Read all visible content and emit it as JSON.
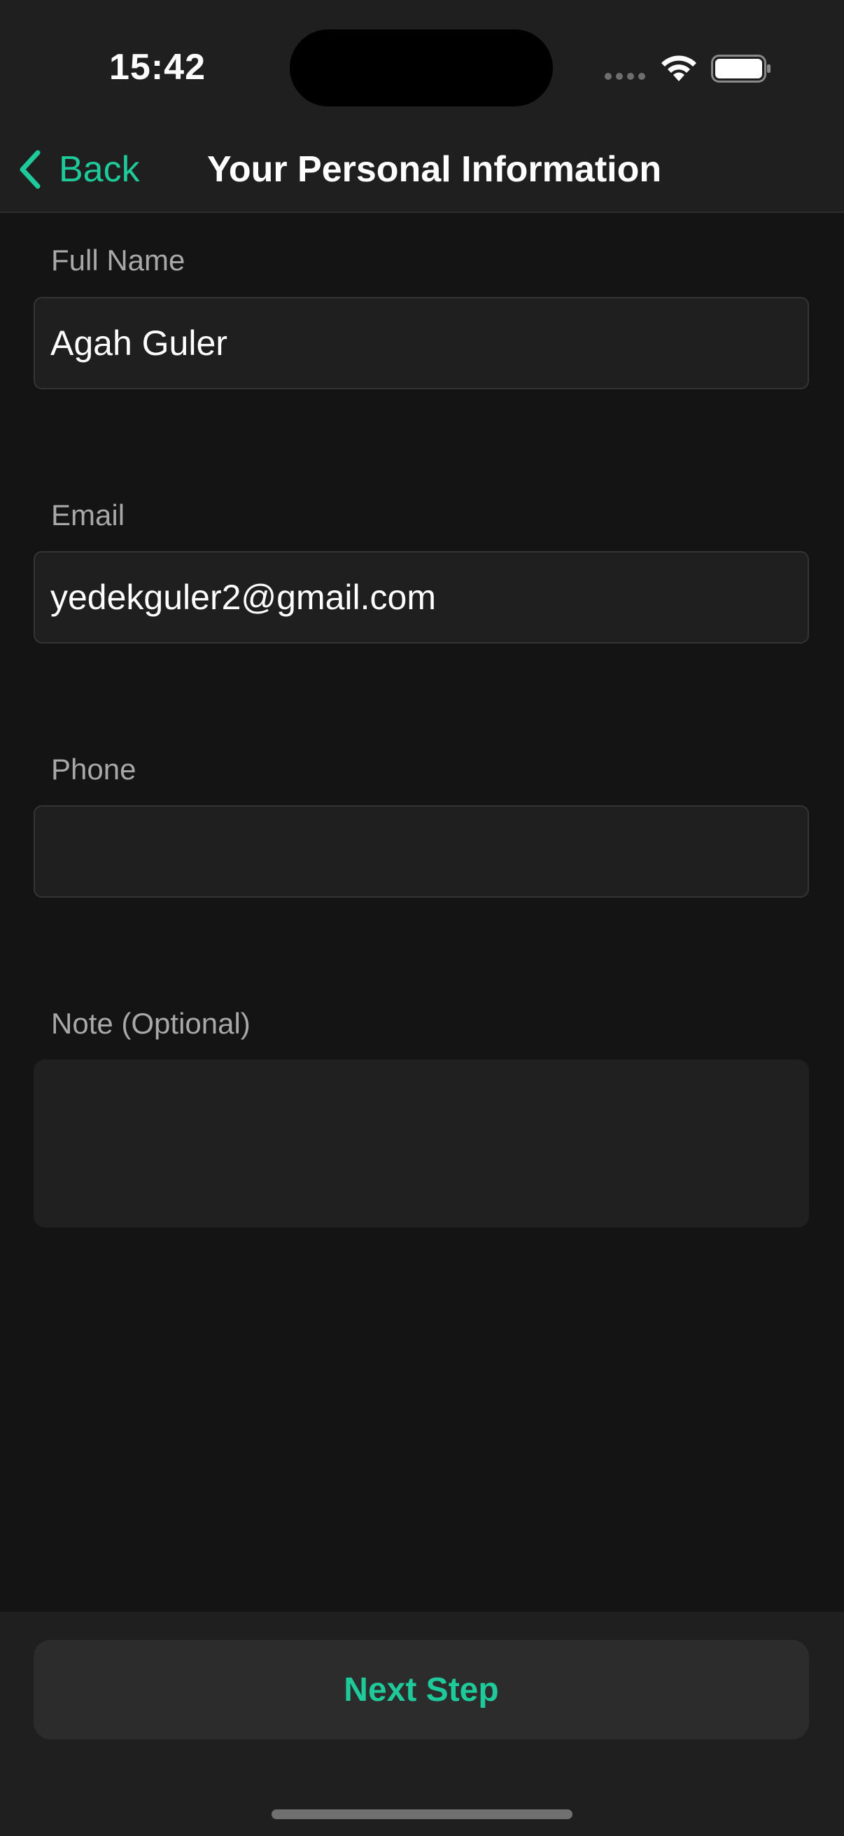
{
  "status_bar": {
    "time": "15:42",
    "icons": [
      "signal-dots-icon",
      "wifi-icon",
      "battery-icon"
    ]
  },
  "nav": {
    "back_label": "Back",
    "title": "Your Personal Information"
  },
  "form": {
    "full_name": {
      "label": "Full Name",
      "value": "Agah Guler"
    },
    "email": {
      "label": "Email",
      "value": "yedekguler2@gmail.com"
    },
    "phone": {
      "label": "Phone",
      "value": ""
    },
    "note": {
      "label": "Note (Optional)",
      "value": ""
    }
  },
  "footer": {
    "next_label": "Next Step"
  },
  "colors": {
    "accent": "#1ec99a",
    "background": "#141414",
    "surface": "#1f1f1f"
  }
}
